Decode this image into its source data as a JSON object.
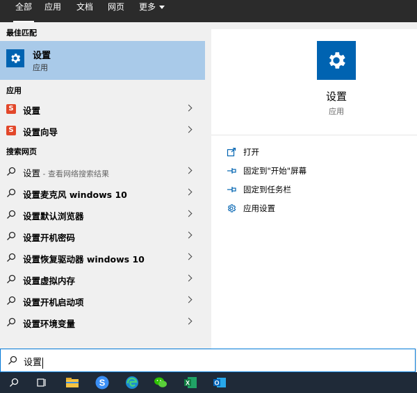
{
  "tabs": [
    {
      "label": "全部",
      "active": true
    },
    {
      "label": "应用"
    },
    {
      "label": "文档"
    },
    {
      "label": "网页"
    },
    {
      "label": "更多"
    }
  ],
  "sections": {
    "best_match": "最佳匹配",
    "apps": "应用",
    "web": "搜索网页"
  },
  "best_match": {
    "title": "设置",
    "subtitle": "应用",
    "icon": "gear-icon"
  },
  "apps": [
    {
      "label": "设置",
      "icon": "app-s-icon"
    },
    {
      "label": "设置向导",
      "icon": "app-s-icon"
    }
  ],
  "web_results": [
    {
      "label": "设置",
      "hint": " - 查看网络搜索结果"
    },
    {
      "label": "设置麦克风 windows 10"
    },
    {
      "label": "设置默认浏览器"
    },
    {
      "label": "设置开机密码"
    },
    {
      "label": "设置恢复驱动器 windows 10"
    },
    {
      "label": "设置虚拟内存"
    },
    {
      "label": "设置开机启动项"
    },
    {
      "label": "设置环境变量"
    }
  ],
  "preview": {
    "title": "设置",
    "subtitle": "应用",
    "actions": [
      {
        "label": "打开",
        "icon": "open-icon"
      },
      {
        "label": "固定到\"开始\"屏幕",
        "icon": "pin-icon"
      },
      {
        "label": "固定到任务栏",
        "icon": "pin-icon"
      },
      {
        "label": "应用设置",
        "icon": "gear-icon"
      }
    ]
  },
  "search": {
    "value": "设置"
  },
  "colors": {
    "accent": "#0078d7",
    "selected": "#a9cae9",
    "tab_bar": "#2b2b2b",
    "taskbar": "#1f2a38"
  },
  "taskbar_icons": [
    "search-icon",
    "task-view-icon",
    "file-explorer-icon",
    "sogou-icon",
    "edge-icon",
    "wechat-icon",
    "excel-icon",
    "outlook-icon"
  ]
}
